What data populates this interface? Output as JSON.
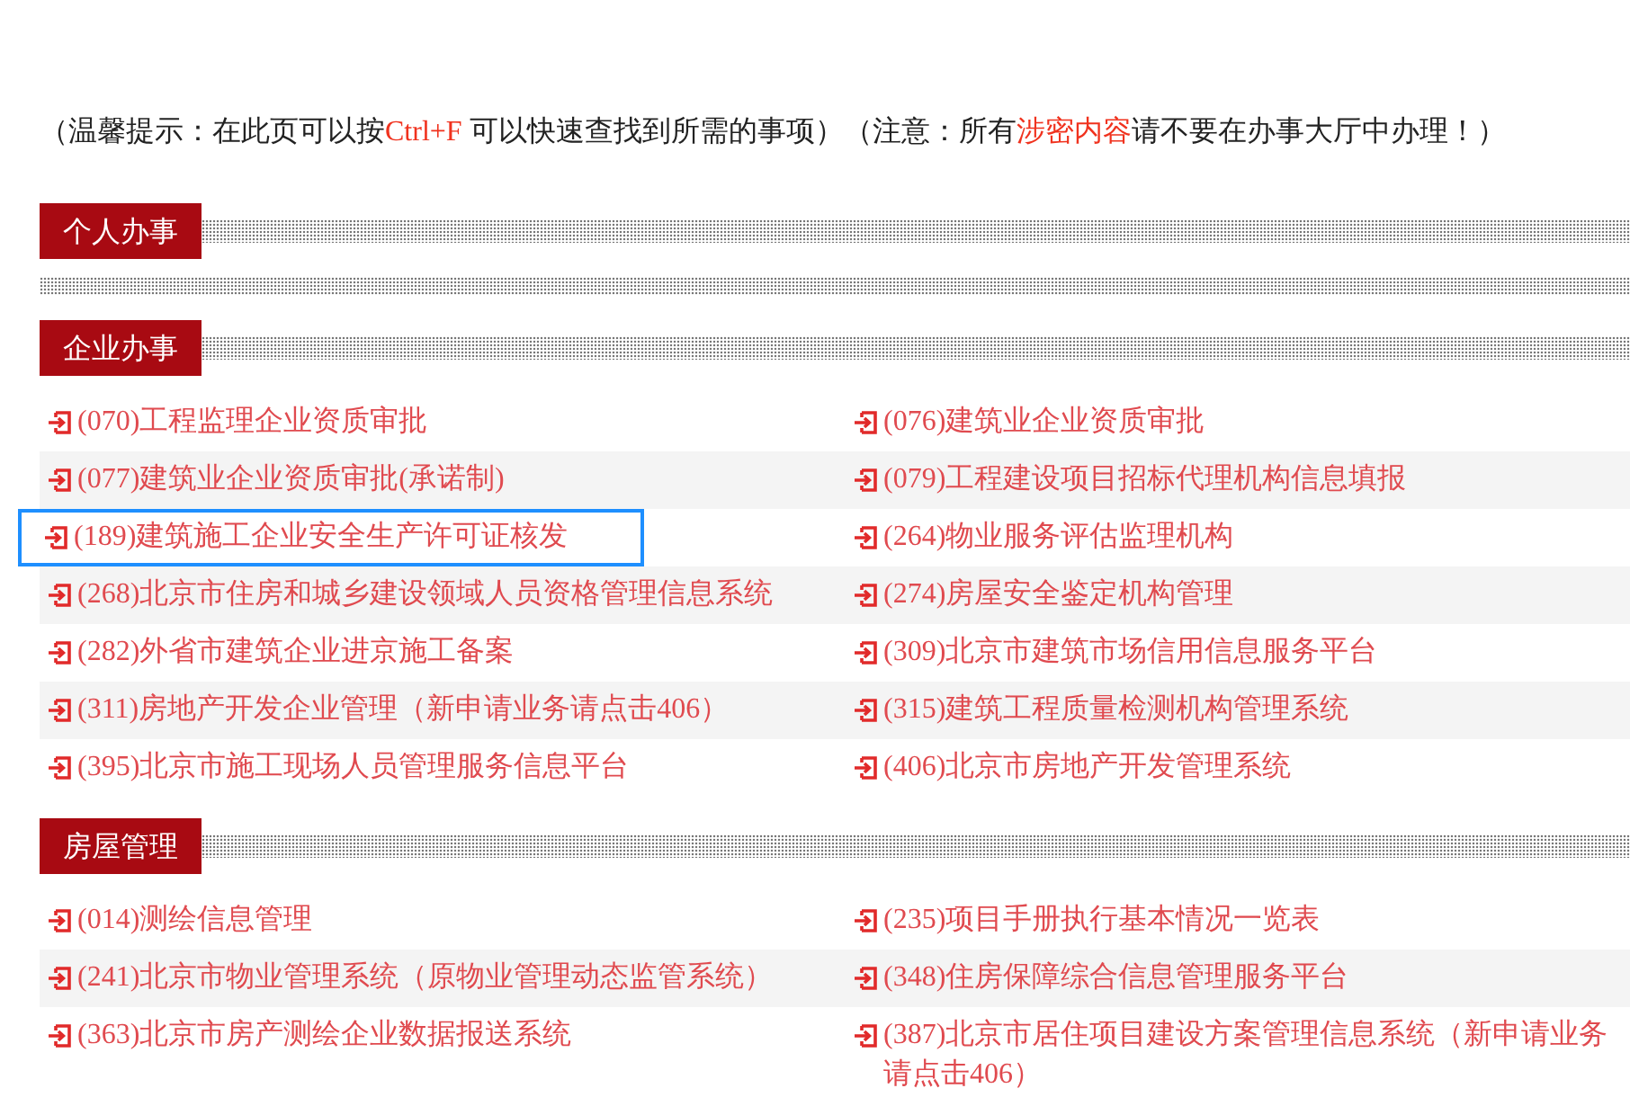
{
  "notice": [
    {
      "text": "（温馨提示：在此页可以按",
      "highlight": false
    },
    {
      "text": "Ctrl+F",
      "highlight": true
    },
    {
      "text": " 可以快速查找到所需的事项）（注意：所有",
      "highlight": false
    },
    {
      "text": "涉密内容",
      "highlight": true
    },
    {
      "text": "请不要在办事大厅中办理！）",
      "highlight": false
    }
  ],
  "sections": [
    {
      "title": "个人办事"
    },
    {
      "title": "企业办事",
      "items": [
        {
          "label": "(070)工程监理企业资质审批",
          "focused": false
        },
        {
          "label": "(076)建筑业企业资质审批",
          "focused": false
        },
        {
          "label": "(077)建筑业企业资质审批(承诺制)",
          "focused": false
        },
        {
          "label": "(079)工程建设项目招标代理机构信息填报",
          "focused": false
        },
        {
          "label": "(189)建筑施工企业安全生产许可证核发",
          "focused": true
        },
        {
          "label": "(264)物业服务评估监理机构",
          "focused": false
        },
        {
          "label": "(268)北京市住房和城乡建设领域人员资格管理信息系统",
          "focused": false
        },
        {
          "label": "(274)房屋安全鉴定机构管理",
          "focused": false
        },
        {
          "label": "(282)外省市建筑企业进京施工备案",
          "focused": false
        },
        {
          "label": "(309)北京市建筑市场信用信息服务平台",
          "focused": false
        },
        {
          "label": "(311)房地产开发企业管理（新申请业务请点击406）",
          "focused": false
        },
        {
          "label": "(315)建筑工程质量检测机构管理系统",
          "focused": false
        },
        {
          "label": "(395)北京市施工现场人员管理服务信息平台",
          "focused": false
        },
        {
          "label": "(406)北京市房地产开发管理系统",
          "focused": false
        }
      ]
    },
    {
      "title": "房屋管理",
      "items": [
        {
          "label": "(014)测绘信息管理",
          "focused": false
        },
        {
          "label": "(235)项目手册执行基本情况一览表",
          "focused": false
        },
        {
          "label": "(241)北京市物业管理系统（原物业管理动态监管系统）",
          "focused": false
        },
        {
          "label": "(348)住房保障综合信息管理服务平台",
          "focused": false
        },
        {
          "label": "(363)北京市房产测绘企业数据报送系统",
          "focused": false
        },
        {
          "label": "(387)北京市居住项目建设方案管理信息系统（新申请业务请点击406）",
          "focused": false
        }
      ]
    }
  ]
}
